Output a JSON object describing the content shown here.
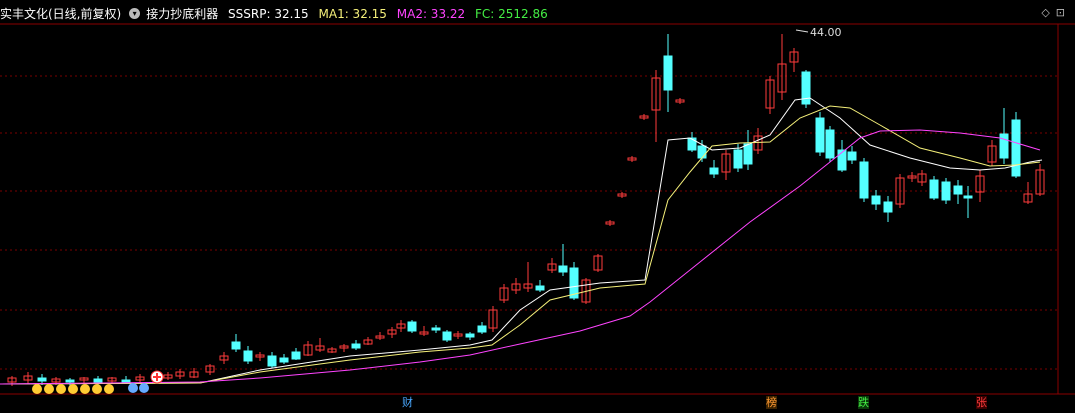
{
  "header": {
    "stock_name": "实丰文化(日线,前复权)",
    "indicator_name": "接力抄底利器",
    "sssrp": "SSSRP: 32.15",
    "ma1": "MA1: 32.15",
    "ma2": "MA2: 33.22",
    "fc": "FC: 2512.86"
  },
  "colors": {
    "up": "#ff3c3c",
    "down": "#54ffff",
    "sssrp": "#ffffff",
    "ma1": "#f5f07a",
    "ma2": "#ff44ff",
    "fc": "#44ee44",
    "grid": "#7a0000"
  },
  "peak_label": "44.00",
  "top_icons": [
    "diamond-icon",
    "restore-icon"
  ],
  "bottom_labels": [
    {
      "text": "财",
      "color": "#4aa8ff"
    },
    {
      "text": "榜",
      "color": "#ff9933"
    },
    {
      "text": "跌",
      "color": "#44ee44"
    },
    {
      "text": "张",
      "color": "#ff3c3c"
    }
  ]
}
